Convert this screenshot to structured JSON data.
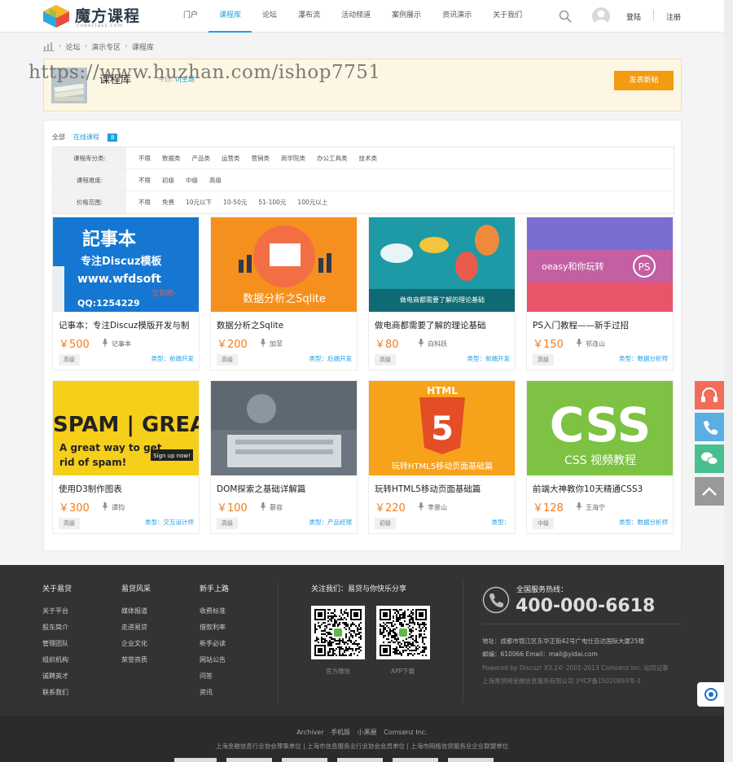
{
  "brand": {
    "name": "魔方课程",
    "sub": "cubeclass.com"
  },
  "nav": {
    "items": [
      "门户",
      "课程库",
      "论坛",
      "瀑布流",
      "活动频道",
      "案例展示",
      "资讯演示",
      "关于我们"
    ],
    "active": 1
  },
  "header": {
    "login": "登陆",
    "register": "注册"
  },
  "breadcrumb": [
    "论坛",
    "演示专区",
    "课程库"
  ],
  "watermark": "https://www.huzhan.com/ishop7751",
  "forum": {
    "title": "课程库",
    "meta_prefix": "今日: ",
    "meta_link": "0|主题",
    "post_button": "发表新帖"
  },
  "tabs": {
    "all": "全部",
    "current": "在线课程",
    "count": "8"
  },
  "filters": [
    {
      "label": "课程库分类:",
      "options": [
        "不限",
        "数据类",
        "产品类",
        "运营类",
        "营销类",
        "商学院类",
        "办公工具类",
        "技术类"
      ]
    },
    {
      "label": "课程难度:",
      "options": [
        "不限",
        "初级",
        "中级",
        "高级"
      ]
    },
    {
      "label": "价格范围:",
      "options": [
        "不限",
        "免费",
        "10元以下",
        "10-50元",
        "51-100元",
        "100元以上"
      ]
    }
  ],
  "courses": [
    {
      "title": "记事本：专注Discuz模版开发与制",
      "price": "￥500",
      "author": "记事本",
      "level": "高级",
      "type": "类型：前端开发",
      "img": {
        "bg": "#1577d1",
        "lines": [
          "記事本",
          "专注Discuz模板",
          "www.wfdsoft",
          "-立刻抢-",
          "QQ:1254229"
        ]
      }
    },
    {
      "title": "数据分析之Sqlite",
      "price": "￥200",
      "author": "加菲",
      "level": "高级",
      "type": "类型：后端开发",
      "img": {
        "bg": "#f5901e",
        "lines": [
          "数据分析之Sqlite"
        ]
      }
    },
    {
      "title": "做电商都需要了解的理论基础",
      "price": "￥80",
      "author": "白科跃",
      "level": "高级",
      "type": "类型：前端开发",
      "img": {
        "bg": "#1d9aa6",
        "lines": [
          "做电商都需要了解的理论基础"
        ]
      }
    },
    {
      "title": "PS入门教程——新手过招",
      "price": "￥150",
      "author": "祁连山",
      "level": "高级",
      "type": "类型：数据分析师",
      "img": {
        "bg": "#e9546b",
        "lines": [
          "oeasy和你玩转",
          "PS"
        ]
      }
    },
    {
      "title": "使用D3制作图表",
      "price": "￥300",
      "author": "谭钧",
      "level": "高级",
      "type": "类型：交互设计师",
      "img": {
        "bg": "#f6cf1b",
        "lines": [
          "SPAM | GREAT",
          "A great way to get",
          "rid of spam!",
          "Sign up now!"
        ]
      }
    },
    {
      "title": "DOM探索之基础详解篇",
      "price": "￥100",
      "author": "慕容",
      "level": "高级",
      "type": "类型：产品经理",
      "img": {
        "bg": "#6d7580",
        "lines": []
      }
    },
    {
      "title": "玩转HTML5移动页面基础篇",
      "price": "￥220",
      "author": "李景山",
      "level": "初级",
      "type": "类型：",
      "img": {
        "bg": "#f7a21b",
        "lines": [
          "HTML",
          "5",
          "玩转HTML5移动页面基础篇"
        ]
      }
    },
    {
      "title": "前端大神教你10天精通CSS3",
      "price": "￥128",
      "author": "王海宁",
      "level": "中级",
      "type": "类型：数据分析师",
      "img": {
        "bg": "#7dc243",
        "lines": [
          "CSS",
          "CSS 视频教程"
        ]
      }
    }
  ],
  "footer": {
    "cols": [
      {
        "head": "关于易贷",
        "items": [
          "关于平台",
          "股东简介",
          "管理团队",
          "组织机构",
          "诚聘英才",
          "联系我们"
        ]
      },
      {
        "head": "易贷风采",
        "items": [
          "媒体报道",
          "走进易贷",
          "企业文化",
          "荣誉资质"
        ]
      },
      {
        "head": "新手上路",
        "items": [
          "收费标准",
          "借款利率",
          "新手必读",
          "网站公告",
          "问答",
          "资讯"
        ]
      }
    ],
    "follow": "关注我们：易贷与你快乐分享",
    "qr_labels": [
      "官方微信",
      "APP下载"
    ],
    "hotline_label": "全国服务热线：",
    "hotline": "400-000-6618",
    "address": "地址：成都市锦江区东华正街42号广电仕百达国际大厦25楼",
    "email": "邮编：610066 Email：mail@yidai.com",
    "powered": "Powered by Discuz! X3.2© 2001-2013 Comsenz Inc. 站同记事",
    "company": "上海易贷网金融信息服务有限公司  沪ICP备15020893号-1"
  },
  "bottom": {
    "links": [
      "Archiver",
      "手机版",
      "小黑屋",
      "Comsenz Inc."
    ],
    "note": "上海金融信息行业协会理事单位 | 上海市信息服务业行业协会会员单位 | 上海市网络信贷服务业企业联盟单位"
  }
}
